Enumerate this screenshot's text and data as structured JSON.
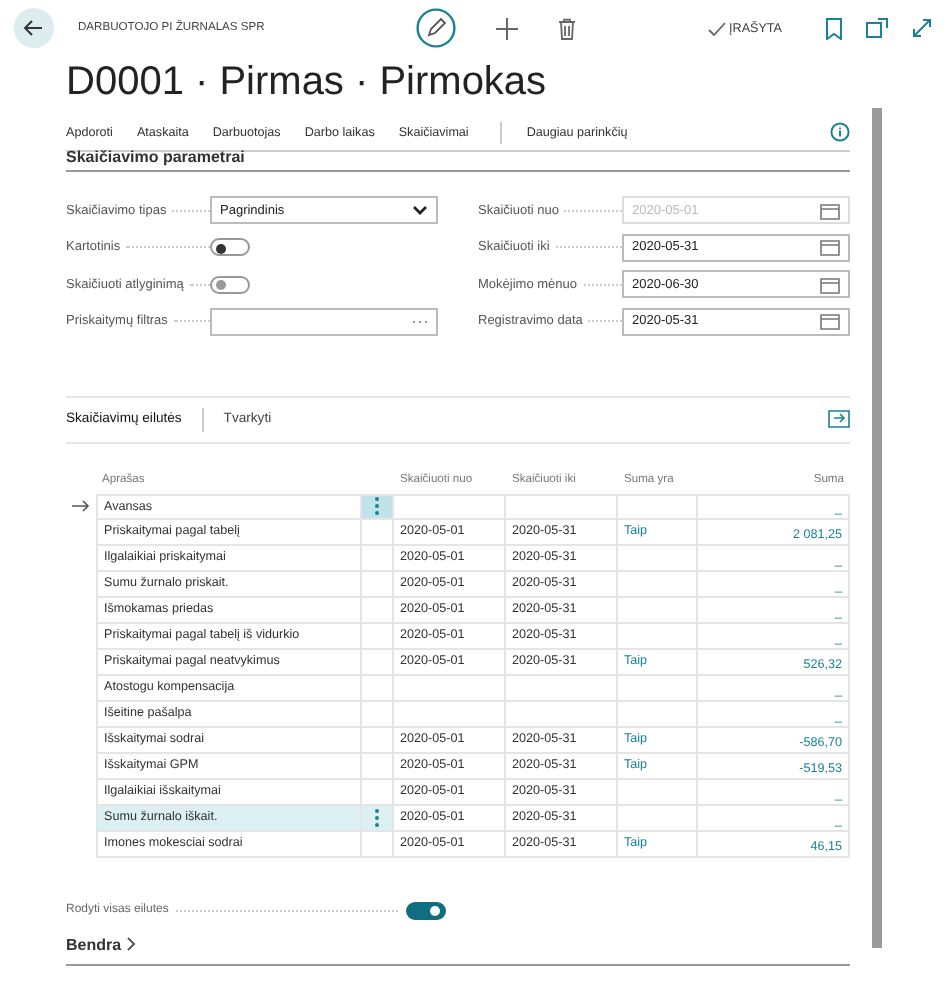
{
  "header": {
    "breadcrumb": "DARBUOTOJO PI ŽURNALAS SPR",
    "status": "ĮRAŠYTA",
    "title": "D0001 · Pirmas · Pirmokas"
  },
  "actions": [
    {
      "label": "Apdoroti"
    },
    {
      "label": "Ataskaita"
    },
    {
      "label": "Darbuotojas"
    },
    {
      "label": "Darbo laikas"
    },
    {
      "label": "Skaičiavimai"
    }
  ],
  "more_options": "Daugiau parinkčių",
  "section_title": "Skaičiavimo parametrai",
  "left_fields": [
    {
      "kind": "select",
      "label": "Skaičiavimo tipas",
      "value": "Pagrindinis"
    },
    {
      "kind": "toggle",
      "label": "Kartotinis",
      "on": false,
      "disabled": false
    },
    {
      "kind": "toggle",
      "label": "Skaičiuoti atlyginimą",
      "on": false,
      "disabled": true
    },
    {
      "kind": "lookup",
      "label": "Priskaitymų filtras"
    }
  ],
  "right_fields": [
    {
      "kind": "date",
      "label": "Skaičiuoti nuo",
      "value": "2020-05-01",
      "disabled": true
    },
    {
      "kind": "date",
      "label": "Skaičiuoti iki",
      "value": "2020-05-31",
      "disabled": false
    },
    {
      "kind": "date",
      "label": "Mokėjimo mėnuo",
      "value": "2020-06-30",
      "disabled": false
    },
    {
      "kind": "date",
      "label": "Registravimo data",
      "value": "2020-05-31",
      "disabled": false
    }
  ],
  "lines": {
    "tabs": [
      {
        "label": "Skaičiavimų eilutės",
        "selected": true
      },
      {
        "label": "Tvarkyti",
        "selected": false
      }
    ],
    "columns": [
      "Aprašas",
      "Skaičiuoti nuo",
      "Skaičiuoti iki",
      "Suma yra",
      "Suma"
    ],
    "rows": [
      {
        "name": "Avansas",
        "from": "",
        "to": "",
        "suma_yra": "",
        "suma": "_",
        "current": true,
        "selected": false
      },
      {
        "name": "Priskaitymai pagal tabelį",
        "from": "2020-05-01",
        "to": "2020-05-31",
        "suma_yra": "Taip",
        "suma": "2 081,25",
        "current": false,
        "selected": false
      },
      {
        "name": "Ilgalaikiai priskaitymai",
        "from": "2020-05-01",
        "to": "2020-05-31",
        "suma_yra": "",
        "suma": "_",
        "current": false,
        "selected": false
      },
      {
        "name": "Sumu žurnalo priskait.",
        "from": "2020-05-01",
        "to": "2020-05-31",
        "suma_yra": "",
        "suma": "_",
        "current": false,
        "selected": false
      },
      {
        "name": "Išmokamas priedas",
        "from": "2020-05-01",
        "to": "2020-05-31",
        "suma_yra": "",
        "suma": "_",
        "current": false,
        "selected": false
      },
      {
        "name": "Priskaitymai pagal tabelį iš vidurkio",
        "from": "2020-05-01",
        "to": "2020-05-31",
        "suma_yra": "",
        "suma": "_",
        "current": false,
        "selected": false
      },
      {
        "name": "Priskaitymai pagal neatvykimus",
        "from": "2020-05-01",
        "to": "2020-05-31",
        "suma_yra": "Taip",
        "suma": "526,32",
        "current": false,
        "selected": false
      },
      {
        "name": "Atostogu kompensacija",
        "from": "",
        "to": "",
        "suma_yra": "",
        "suma": "_",
        "current": false,
        "selected": false
      },
      {
        "name": "Išeitine pašalpa",
        "from": "",
        "to": "",
        "suma_yra": "",
        "suma": "_",
        "current": false,
        "selected": false
      },
      {
        "name": "Išskaitymai sodrai",
        "from": "2020-05-01",
        "to": "2020-05-31",
        "suma_yra": "Taip",
        "suma": "-586,70",
        "current": false,
        "selected": false
      },
      {
        "name": "Išskaitymai GPM",
        "from": "2020-05-01",
        "to": "2020-05-31",
        "suma_yra": "Taip",
        "suma": "-519,53",
        "current": false,
        "selected": false
      },
      {
        "name": "Ilgalaikiai išskaitymai",
        "from": "2020-05-01",
        "to": "2020-05-31",
        "suma_yra": "",
        "suma": "_",
        "current": false,
        "selected": false
      },
      {
        "name": "Sumu žurnalo iškait.",
        "from": "2020-05-01",
        "to": "2020-05-31",
        "suma_yra": "",
        "suma": "_",
        "current": false,
        "selected": true
      },
      {
        "name": "Imones mokesciai sodrai",
        "from": "2020-05-01",
        "to": "2020-05-31",
        "suma_yra": "Taip",
        "suma": "46,15",
        "current": false,
        "selected": false
      }
    ]
  },
  "show_all": {
    "label": "Rodyti visas eilutes",
    "on": true
  },
  "general_section": "Bendra"
}
